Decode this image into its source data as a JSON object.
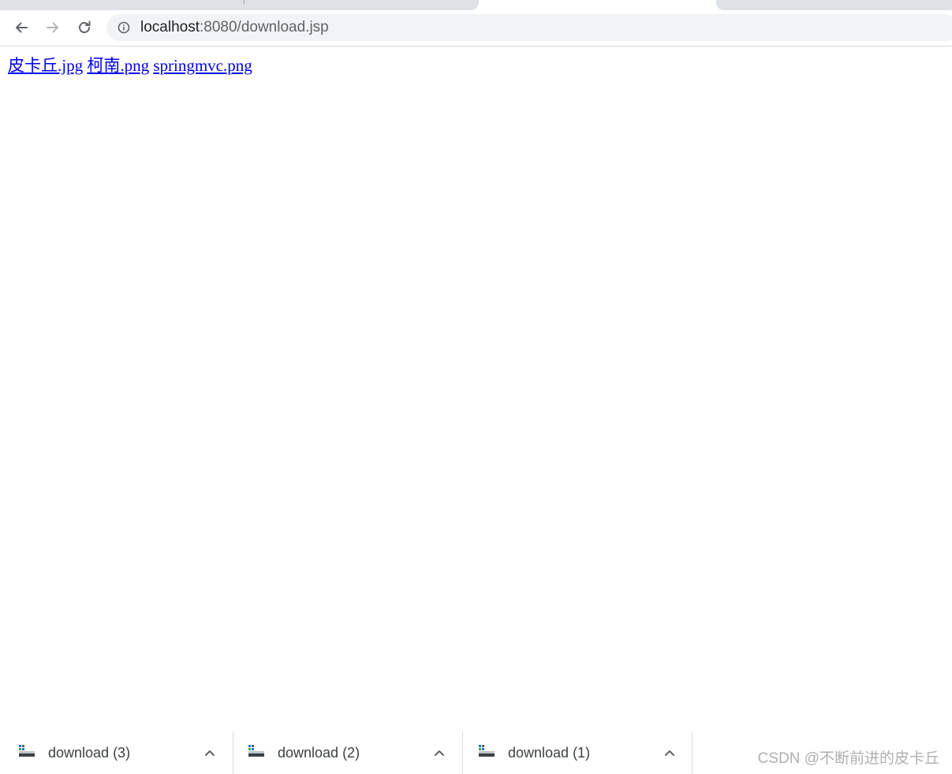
{
  "browser": {
    "address_bar": {
      "host": "localhost",
      "path": ":8080/download.jsp"
    },
    "buttons": {
      "back_icon": "arrow-left-icon",
      "forward_icon": "arrow-right-icon",
      "reload_icon": "reload-icon",
      "site_info_icon": "info-circle-icon"
    }
  },
  "page": {
    "links": [
      {
        "label": "皮卡丘.jpg"
      },
      {
        "label": "柯南.png"
      },
      {
        "label": "springmvc.png"
      }
    ],
    "link_color": "#0000ee"
  },
  "download_shelf": {
    "items": [
      {
        "name": "download (3)",
        "icon": "file-icon",
        "menu_icon": "chevron-up-icon"
      },
      {
        "name": "download (2)",
        "icon": "file-icon",
        "menu_icon": "chevron-up-icon"
      },
      {
        "name": "download (1)",
        "icon": "file-icon",
        "menu_icon": "chevron-up-icon"
      }
    ]
  },
  "watermark": {
    "text": "CSDN @不断前进的皮卡丘"
  }
}
